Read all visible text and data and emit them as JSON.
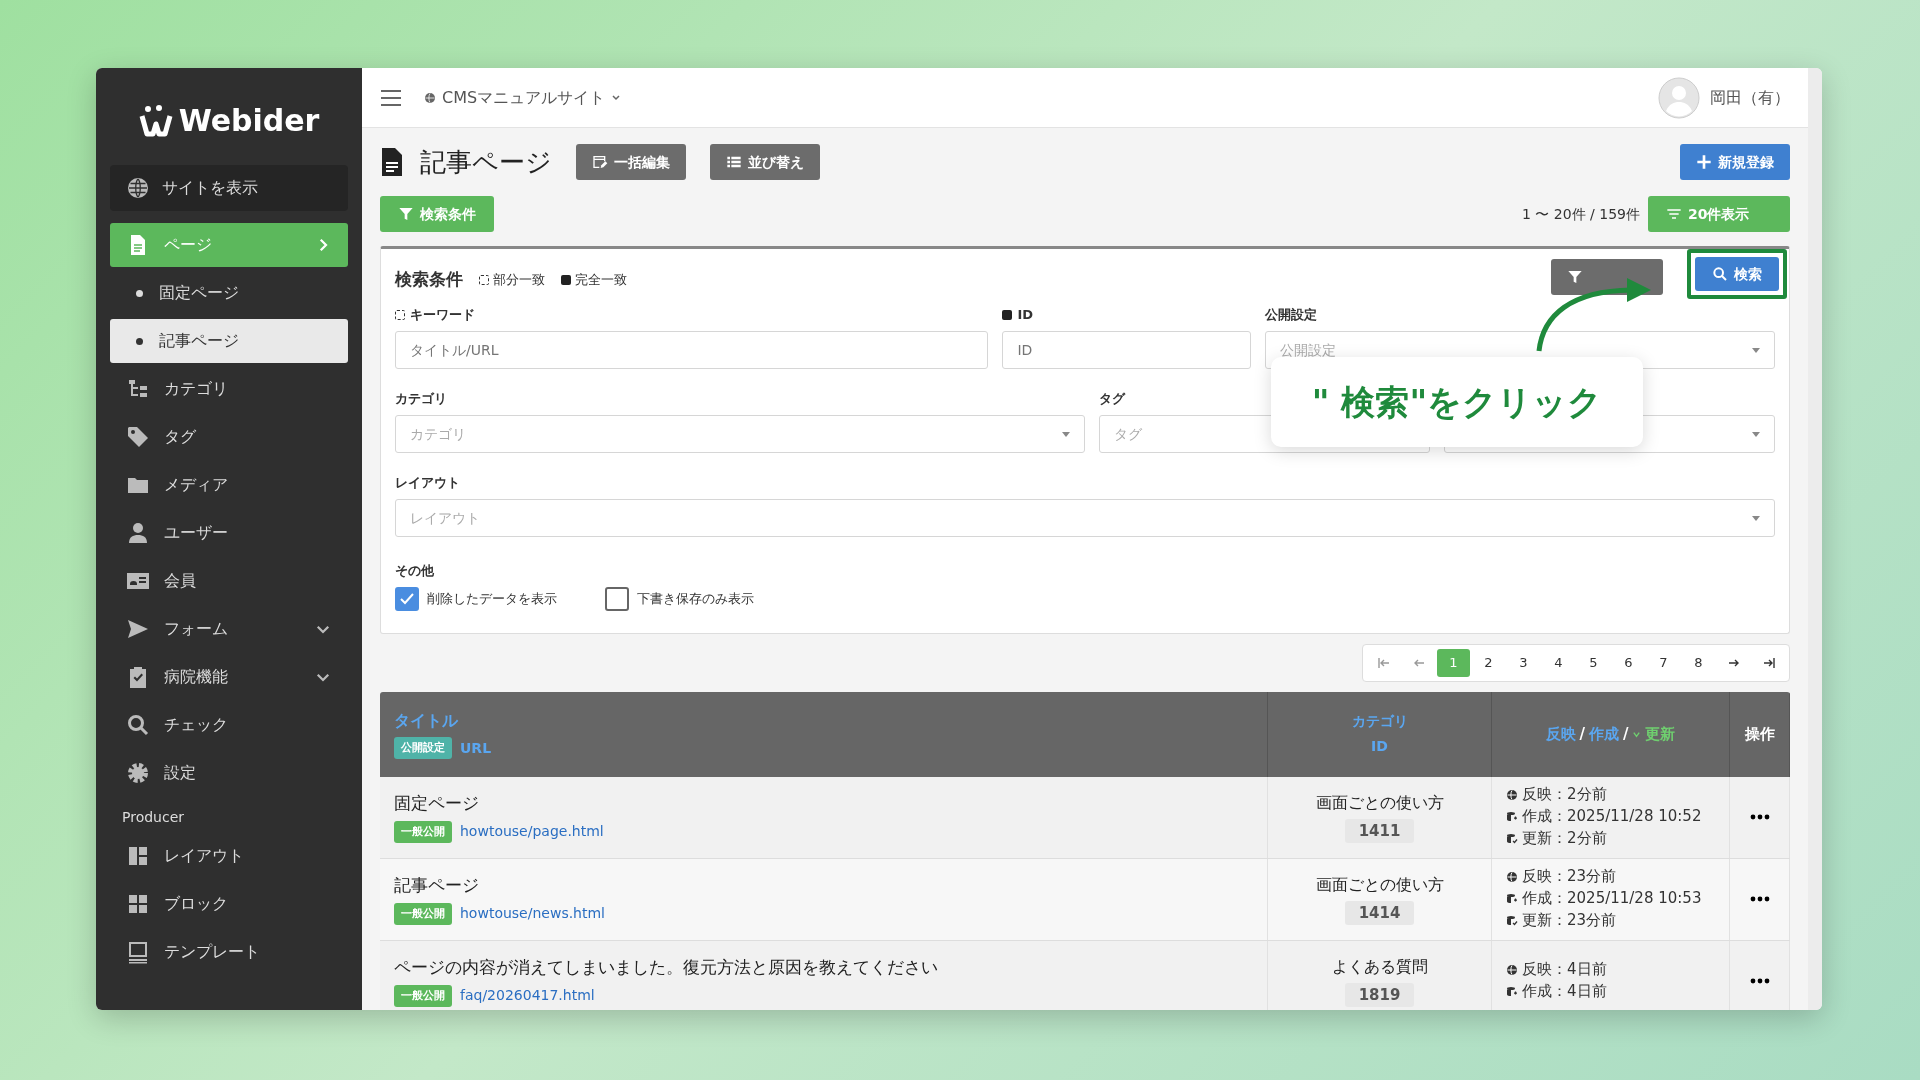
{
  "sidebar": {
    "logo": "Webider",
    "view_site": "サイトを表示",
    "items": [
      {
        "label": "ページ",
        "kind": "group",
        "selected": true,
        "expanded": true,
        "children": [
          {
            "label": "固定ページ",
            "selected": false
          },
          {
            "label": "記事ページ",
            "selected": true
          }
        ]
      },
      {
        "label": "カテゴリ",
        "kind": "link",
        "selected": false
      },
      {
        "label": "タグ",
        "kind": "link",
        "selected": false
      },
      {
        "label": "メディア",
        "kind": "link",
        "selected": false
      },
      {
        "label": "ユーザー",
        "kind": "link",
        "selected": false
      },
      {
        "label": "会員",
        "kind": "link",
        "selected": false
      },
      {
        "label": "フォーム",
        "kind": "group",
        "selected": false,
        "expanded": false
      },
      {
        "label": "病院機能",
        "kind": "group",
        "selected": false,
        "expanded": false
      },
      {
        "label": "チェック",
        "kind": "link",
        "selected": false
      },
      {
        "label": "設定",
        "kind": "link",
        "selected": false
      }
    ],
    "section": "Producer",
    "producer_items": [
      {
        "label": "レイアウト",
        "selected": false
      },
      {
        "label": "ブロック",
        "selected": false
      },
      {
        "label": "テンプレート",
        "selected": false
      }
    ]
  },
  "header": {
    "site": "CMSマニュアルサイト",
    "user": "岡田（有）"
  },
  "page": {
    "title": "記事ページ",
    "buttons": [
      {
        "label": "一括編集"
      },
      {
        "label": "並び替え"
      }
    ],
    "new_button": "新規登録",
    "filter_button": "検索条件",
    "count": "1 〜 20件 / 159件",
    "per_page_button": "20件表示"
  },
  "search": {
    "title": "検索条件",
    "legend": [
      {
        "label": "部分一致",
        "kind": "partial"
      },
      {
        "label": "完全一致",
        "kind": "exact"
      }
    ],
    "rows": [
      [
        {
          "label": "キーワード",
          "exact_match": false,
          "kind": "text",
          "placeholder": "タイトル/URL"
        },
        {
          "label": "ID",
          "exact_match": true,
          "kind": "text",
          "placeholder": "ID"
        },
        {
          "label": "公開設定",
          "kind": "select",
          "placeholder": "公開設定"
        }
      ],
      [
        {
          "label": "カテゴリ",
          "kind": "select",
          "placeholder": "カテゴリ"
        },
        {
          "label": "タグ",
          "kind": "select",
          "placeholder": "タグ"
        },
        {
          "kind": "select"
        }
      ],
      [
        {
          "label": "レイアウト",
          "kind": "select",
          "placeholder": "レイアウト"
        }
      ]
    ],
    "other_label": "その他",
    "options": [
      {
        "label": "削除したデータを表示",
        "checked": true
      },
      {
        "label": "下書き保存のみ表示",
        "checked": false
      }
    ],
    "search_button": "検索"
  },
  "callout": {
    "text": "\" 検索\"をクリック"
  },
  "pagination": {
    "pages": [
      {
        "label": "1",
        "selected": true
      },
      {
        "label": "2",
        "selected": false
      },
      {
        "label": "3",
        "selected": false
      },
      {
        "label": "4",
        "selected": false
      },
      {
        "label": "5",
        "selected": false
      },
      {
        "label": "6",
        "selected": false
      },
      {
        "label": "7",
        "selected": false
      },
      {
        "label": "8",
        "selected": false
      }
    ]
  },
  "table": {
    "columns": {
      "title": "タイトル",
      "status": "公開設定",
      "url": "URL",
      "category": "カテゴリ",
      "id": "ID",
      "separator": "/",
      "dates": [
        {
          "label": "反映",
          "sorted": false
        },
        {
          "label": "作成",
          "sorted": false
        },
        {
          "label": "更新",
          "sorted": true
        }
      ],
      "actions": "操作"
    },
    "rows": [
      {
        "title": "固定ページ",
        "status": "一般公開",
        "url": "howtouse/page.html",
        "category": "画面ごとの使い方",
        "id": "1411",
        "dates": [
          {
            "kind": "published",
            "text": "反映：2分前"
          },
          {
            "kind": "created",
            "text": "作成：2025/11/28 10:52"
          },
          {
            "kind": "updated",
            "text": "更新：2分前"
          }
        ]
      },
      {
        "title": "記事ページ",
        "status": "一般公開",
        "url": "howtouse/news.html",
        "category": "画面ごとの使い方",
        "id": "1414",
        "dates": [
          {
            "kind": "published",
            "text": "反映：23分前"
          },
          {
            "kind": "created",
            "text": "作成：2025/11/28 10:53"
          },
          {
            "kind": "updated",
            "text": "更新：23分前"
          }
        ]
      },
      {
        "title": "ページの内容が消えてしまいました。復元方法と原因を教えてください",
        "status": "一般公開",
        "url": "faq/20260417.html",
        "category": "よくある質問",
        "id": "1819",
        "dates": [
          {
            "kind": "published",
            "text": "反映：4日前"
          },
          {
            "kind": "created",
            "text": "作成：4日前"
          }
        ]
      }
    ]
  }
}
